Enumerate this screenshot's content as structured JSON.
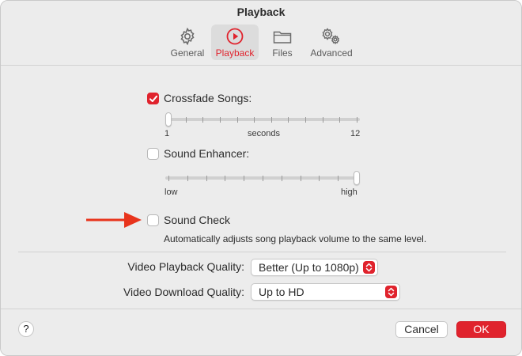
{
  "window": {
    "title": "Playback"
  },
  "tabs": [
    {
      "label": "General",
      "icon": "gear-icon"
    },
    {
      "label": "Playback",
      "icon": "play-circle-icon",
      "active": true
    },
    {
      "label": "Files",
      "icon": "folder-icon"
    },
    {
      "label": "Advanced",
      "icon": "gears-icon"
    }
  ],
  "crossfade": {
    "label": "Crossfade Songs:",
    "checked": true,
    "min_label": "1",
    "unit_label": "seconds",
    "max_label": "12",
    "value": 1
  },
  "sound_enhancer": {
    "label": "Sound Enhancer:",
    "checked": false,
    "min_label": "low",
    "max_label": "high",
    "level": 1.0
  },
  "sound_check": {
    "label": "Sound Check",
    "checked": false,
    "description": "Automatically adjusts song playback volume to the same level."
  },
  "video": {
    "playback_label": "Video Playback Quality:",
    "playback_value": "Better (Up to 1080p)",
    "download_label": "Video Download Quality:",
    "download_value": "Up to HD"
  },
  "footer": {
    "help_label": "?",
    "cancel_label": "Cancel",
    "ok_label": "OK"
  },
  "colors": {
    "accent": "#e0232d",
    "annotation_arrow": "#e8341c"
  }
}
